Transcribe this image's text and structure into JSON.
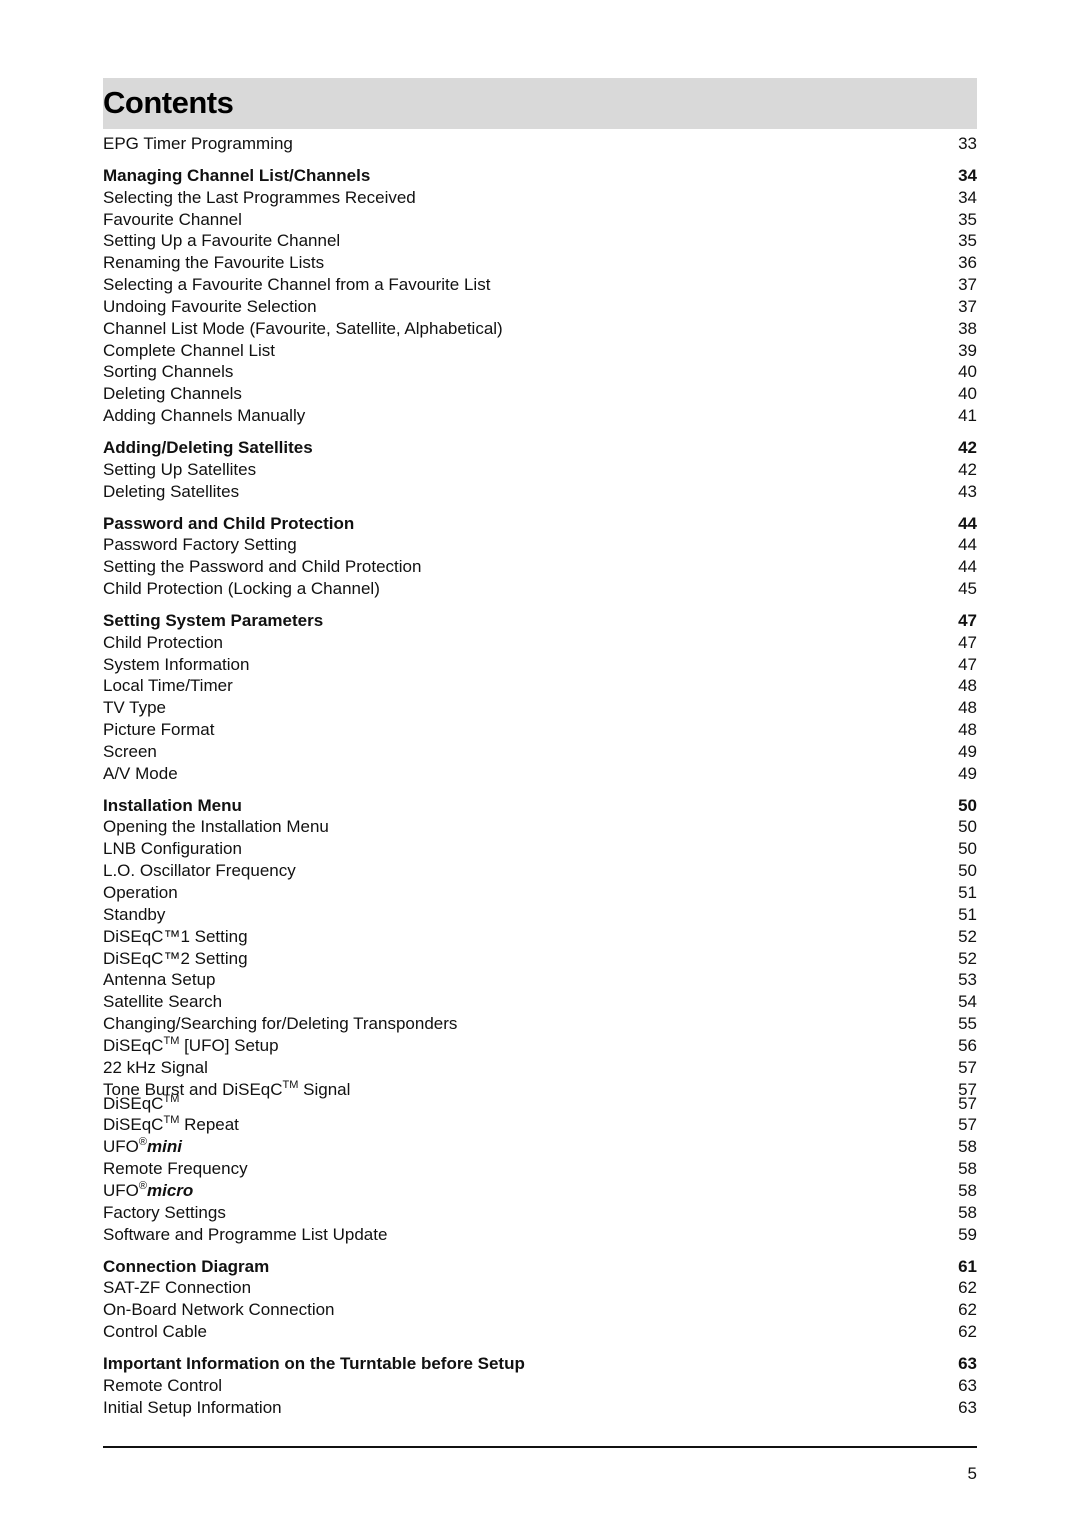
{
  "title": "Contents",
  "entries": [
    {
      "label": "EPG Timer Programming",
      "page": "33",
      "type": "item"
    },
    {
      "label": "Managing Channel List/Channels",
      "page": "34",
      "type": "section"
    },
    {
      "label": "Selecting the Last Programmes Received",
      "page": "34",
      "type": "item"
    },
    {
      "label": "Favourite Channel",
      "page": "35",
      "type": "item"
    },
    {
      "label": "Setting Up a Favourite Channel",
      "page": "35",
      "type": "item"
    },
    {
      "label": "Renaming the Favourite Lists",
      "page": "36",
      "type": "item"
    },
    {
      "label": "Selecting a Favourite Channel from a Favourite List",
      "page": "37",
      "type": "item"
    },
    {
      "label": "Undoing Favourite Selection",
      "page": "37",
      "type": "item"
    },
    {
      "label": "Channel List Mode (Favourite, Satellite, Alphabetical)",
      "page": "38",
      "type": "item"
    },
    {
      "label": "Complete Channel List",
      "page": "39",
      "type": "item"
    },
    {
      "label": "Sorting Channels",
      "page": "40",
      "type": "item"
    },
    {
      "label": "Deleting Channels",
      "page": "40",
      "type": "item"
    },
    {
      "label": "Adding Channels Manually",
      "page": "41",
      "type": "item"
    },
    {
      "label": "Adding/Deleting Satellites",
      "page": "42",
      "type": "section"
    },
    {
      "label": "Setting Up Satellites",
      "page": "42",
      "type": "item"
    },
    {
      "label": "Deleting Satellites",
      "page": "43",
      "type": "item"
    },
    {
      "label": "Password and Child Protection",
      "page": "44",
      "type": "section"
    },
    {
      "label": "Password Factory Setting",
      "page": "44",
      "type": "item"
    },
    {
      "label": "Setting the Password and Child Protection",
      "page": "44",
      "type": "item"
    },
    {
      "label": "Child Protection (Locking a Channel)",
      "page": "45",
      "type": "item"
    },
    {
      "label": "Setting System Parameters",
      "page": "47",
      "type": "section"
    },
    {
      "label": "Child Protection",
      "page": "47",
      "type": "item"
    },
    {
      "label": "System Information",
      "page": "47",
      "type": "item"
    },
    {
      "label": "Local Time/Timer",
      "page": "48",
      "type": "item"
    },
    {
      "label": "TV Type",
      "page": "48",
      "type": "item"
    },
    {
      "label": "Picture Format",
      "page": "48",
      "type": "item"
    },
    {
      "label": "Screen",
      "page": "49",
      "type": "item"
    },
    {
      "label": "A/V Mode",
      "page": "49",
      "type": "item"
    },
    {
      "label": "Installation Menu",
      "page": "50",
      "type": "section"
    },
    {
      "label": "Opening the Installation Menu",
      "page": "50",
      "type": "item"
    },
    {
      "label": "LNB Configuration",
      "page": "50",
      "type": "item"
    },
    {
      "label": "L.O. Oscillator Frequency",
      "page": "50",
      "type": "item"
    },
    {
      "label": "Operation",
      "page": "51",
      "type": "item"
    },
    {
      "label": "Standby",
      "page": "51",
      "type": "item"
    },
    {
      "label": "DiSEqC™1 Setting",
      "page": "52",
      "type": "item"
    },
    {
      "label": "DiSEqC™2 Setting",
      "page": "52",
      "type": "item"
    },
    {
      "label": "Antenna Setup",
      "page": "53",
      "type": "item"
    },
    {
      "label": "Satellite Search",
      "page": "54",
      "type": "item"
    },
    {
      "label": "Changing/Searching for/Deleting Transponders",
      "page": "55",
      "type": "item"
    },
    {
      "label_parts": [
        "DiSEqC",
        "TM",
        " [UFO] Setup"
      ],
      "page": "56",
      "type": "tm"
    },
    {
      "label": "22 kHz Signal",
      "page": "57",
      "type": "item"
    },
    {
      "label_parts": [
        "Tone Burst and DiSEqC",
        "TM",
        " Signal"
      ],
      "page": "57",
      "type": "tm-tight"
    },
    {
      "label_parts": [
        "DiSEqC",
        "TM",
        ""
      ],
      "page": "57",
      "type": "tm"
    },
    {
      "label_parts": [
        "DiSEqC",
        "TM",
        " Repeat"
      ],
      "page": "57",
      "type": "tm"
    },
    {
      "label_parts": [
        "UFO",
        "®",
        "mini"
      ],
      "page": "58",
      "type": "ufo"
    },
    {
      "label": "Remote Frequency",
      "page": "58",
      "type": "item"
    },
    {
      "label_parts": [
        "UFO",
        "®",
        "micro"
      ],
      "page": "58",
      "type": "ufo"
    },
    {
      "label": "Factory Settings",
      "page": "58",
      "type": "item"
    },
    {
      "label": "Software and Programme List Update",
      "page": "59",
      "type": "item"
    },
    {
      "label": "Connection Diagram",
      "page": "61",
      "type": "section"
    },
    {
      "label": "SAT-ZF Connection",
      "page": "62",
      "type": "item"
    },
    {
      "label": "On-Board Network Connection",
      "page": "62",
      "type": "item"
    },
    {
      "label": "Control Cable",
      "page": "62",
      "type": "item"
    },
    {
      "label": "Important Information on the Turntable before Setup",
      "page": "63",
      "type": "section"
    },
    {
      "label": "Remote Control",
      "page": "63",
      "type": "item"
    },
    {
      "label": "Initial Setup Information",
      "page": "63",
      "type": "item"
    }
  ],
  "footer": {
    "page_number": "5"
  }
}
